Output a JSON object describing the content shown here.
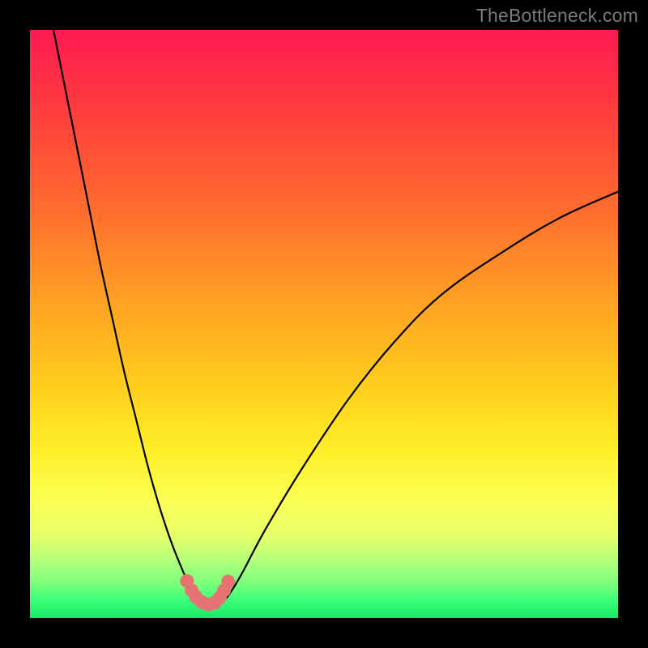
{
  "watermark": "TheBottleneck.com",
  "colors": {
    "frame": "#000000",
    "curve": "#000000",
    "marker": "#e57373",
    "gradient_stops": [
      "#ff1a52",
      "#ff3840",
      "#ff6b2e",
      "#ffa722",
      "#ffd21e",
      "#fff02a",
      "#fbff55",
      "#e7ff6a",
      "#b6ff79",
      "#7dff7c",
      "#3bff78",
      "#17e867"
    ]
  },
  "chart_data": {
    "type": "line",
    "title": "",
    "xlabel": "",
    "ylabel": "",
    "xlim": [
      0,
      100
    ],
    "ylim": [
      0,
      100
    ],
    "grid": false,
    "legend": false,
    "series": [
      {
        "name": "curve",
        "x": [
          4,
          6,
          8,
          10,
          12,
          14,
          16,
          18,
          20,
          22,
          24,
          26,
          27,
          28,
          29,
          30,
          31,
          32,
          33,
          34,
          36,
          40,
          46,
          54,
          62,
          70,
          80,
          90,
          100
        ],
        "y": [
          100,
          90,
          80,
          70,
          60,
          51,
          42,
          34,
          26,
          19,
          13,
          8,
          6,
          4.4,
          3.2,
          2.4,
          2.0,
          2.2,
          3.0,
          4.2,
          7.5,
          15,
          25,
          37,
          47,
          55,
          62,
          68,
          72.5
        ]
      }
    ],
    "markers": [
      {
        "x": 26.7,
        "y": 6.3
      },
      {
        "x": 27.5,
        "y": 4.7
      },
      {
        "x": 28.2,
        "y": 3.6
      },
      {
        "x": 29.2,
        "y": 2.7
      },
      {
        "x": 30.3,
        "y": 2.3
      },
      {
        "x": 31.4,
        "y": 2.6
      },
      {
        "x": 32.3,
        "y": 3.5
      },
      {
        "x": 33.0,
        "y": 4.7
      },
      {
        "x": 33.7,
        "y": 6.2
      }
    ]
  }
}
